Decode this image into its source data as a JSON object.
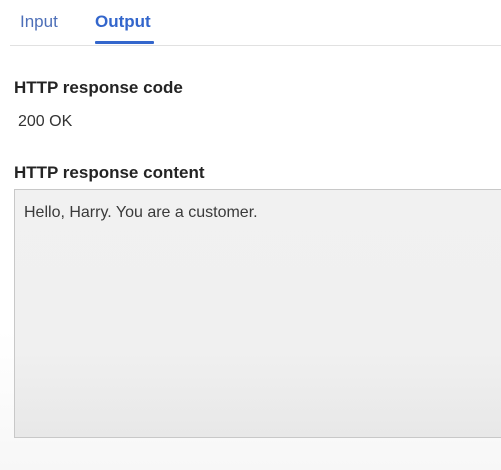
{
  "tabs": [
    {
      "label": "Input",
      "selected": false
    },
    {
      "label": "Output",
      "selected": true
    }
  ],
  "output": {
    "response_code_label": "HTTP response code",
    "response_code_value": "200 OK",
    "response_content_label": "HTTP response content",
    "response_content_value": "Hello, Harry. You are a customer."
  },
  "colors": {
    "accent": "#3366cc",
    "text": "#242424",
    "content_background": "#f0f0f0"
  }
}
